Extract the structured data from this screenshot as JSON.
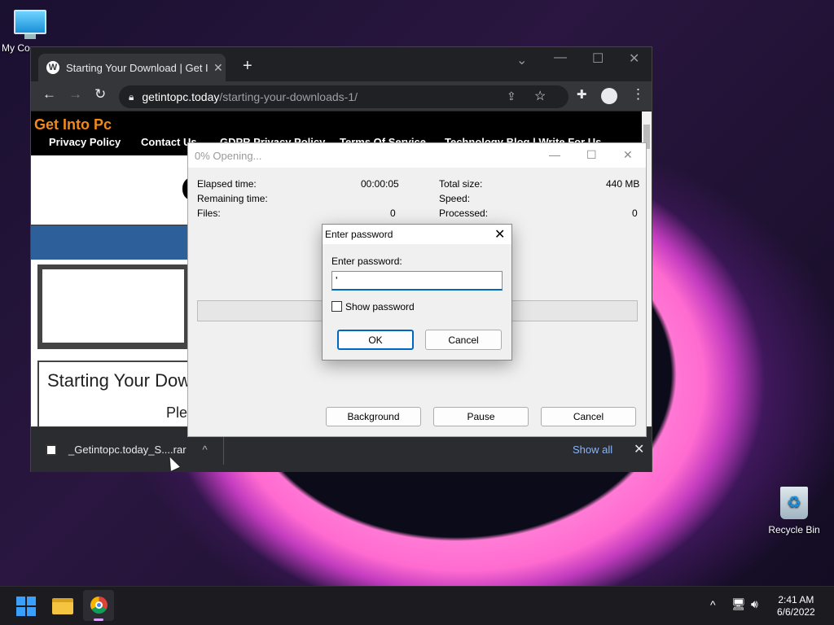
{
  "desktop": {
    "my_computer_label": "My Co",
    "recycle_bin_label": "Recycle Bin"
  },
  "browser": {
    "tab_title": "Starting Your Download | Get Into",
    "url_domain": "getintopc.today",
    "url_path": "/starting-your-downloads-1/",
    "site": {
      "title": "Get Into Pc",
      "nav": [
        "Privacy Policy",
        "Contact Us",
        "GDPR Privacy Policy",
        "Terms Of Service",
        "Technology Blog | Write For Us"
      ],
      "heading": "Starting Your Down",
      "subtext": "Ple"
    },
    "download_bar": {
      "file_name": "_Getintopc.today_S....rar",
      "show_all": "Show all"
    }
  },
  "rar_window": {
    "title": "0% Opening...",
    "elapsed_label": "Elapsed time:",
    "elapsed_value": "00:00:05",
    "remaining_label": "Remaining time:",
    "files_label": "Files:",
    "files_value": "0",
    "total_size_label": "Total size:",
    "total_size_value": "440 MB",
    "speed_label": "Speed:",
    "processed_label": "Processed:",
    "processed_value": "0",
    "progress": 0,
    "background_btn": "Background",
    "pause_btn": "Pause",
    "cancel_btn": "Cancel"
  },
  "password_dialog": {
    "title": "Enter password",
    "field_label": "Enter password:",
    "field_value": "'",
    "show_password_label": "Show password",
    "ok_btn": "OK",
    "cancel_btn": "Cancel"
  },
  "taskbar": {
    "time": "2:41 AM",
    "date": "6/6/2022"
  }
}
